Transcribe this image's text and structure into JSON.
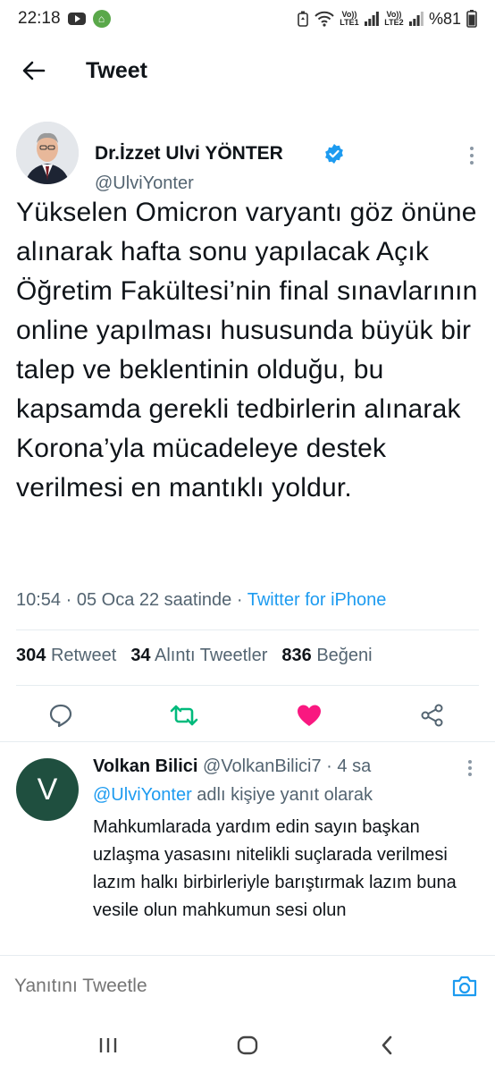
{
  "status_bar": {
    "time": "22:18",
    "battery": "%81",
    "net1": "Vo)) LTE1",
    "net2": "Vo)) LTE2"
  },
  "header": {
    "title": "Tweet"
  },
  "tweet": {
    "author_name": "Dr.İzzet Ulvi YÖNTER",
    "author_handle": "@UlviYonter",
    "text": "Yükselen Omicron varyantı göz önüne alınarak hafta sonu yapılacak Açık Öğretim Fakültesi’nin final sınavlarının online yapılması hususunda büyük bir talep ve beklentinin olduğu, bu kapsamda gerekli tedbirlerin alınarak Korona’yla mücadeleye destek verilmesi en mantıklı yoldur.",
    "time": "10:54",
    "date": "05 Oca 22 saatinde",
    "source": "Twitter for iPhone",
    "stats": {
      "retweets_count": "304",
      "retweets_label": "Retweet",
      "quotes_count": "34",
      "quotes_label": "Alıntı Tweetler",
      "likes_count": "836",
      "likes_label": "Beğeni"
    }
  },
  "reply": {
    "avatar_letter": "V",
    "author_name": "Volkan Bilici",
    "author_handle": "@VolkanBilici7",
    "age": "4 sa",
    "reply_to_handle": "@UlviYonter",
    "reply_to_suffix": "adlı kişiye yanıt olarak",
    "text": "Mahkumlarada yardım edin sayın başkan uzlaşma yasasını nitelikli suçlarada verilmesi lazım halkı birbirleriyle barıştırmak lazım buna vesile olun mahkumun sesi olun"
  },
  "composer": {
    "placeholder": "Yanıtını Tweetle"
  },
  "colors": {
    "link": "#1d9bf0",
    "retweet_green": "#00ba7c",
    "like_pink": "#f91880",
    "muted": "#536471"
  }
}
